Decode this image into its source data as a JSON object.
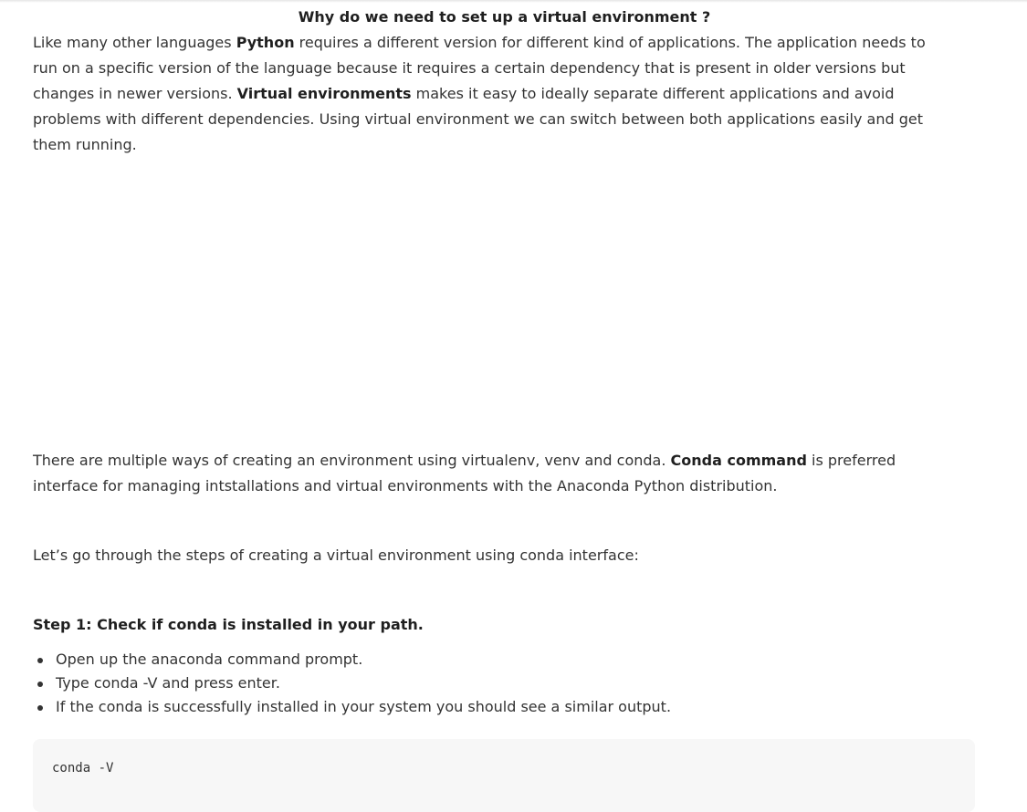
{
  "article": {
    "heading": "Why do we need to set up a virtual environment ?",
    "intro": {
      "t1": "Like many other languages ",
      "b1": "Python",
      "t2": " requires a different version for different kind of applications. The application needs to run on a specific version of the language because it requires a certain dependency that is present in older versions but changes in newer versions. ",
      "b2": "Virtual environments",
      "t3": " makes it easy to ideally separate different applications and avoid problems with different dependencies. Using virtual environment we can switch between both applications easily and get them running."
    },
    "ways": {
      "t1": "There are multiple ways of creating an environment using virtualenv, venv and conda. ",
      "b1": "Conda command",
      "t2": " is preferred interface for managing intstallations and virtual environments with the Anaconda Python distribution."
    },
    "steps_intro": "Let’s go through the steps of creating a virtual environment using conda interface:",
    "step1": {
      "title": "Step 1: Check if conda is installed in your path.",
      "bullets": [
        "Open up the anaconda command prompt.",
        "Type conda -V  and press enter.",
        "If the conda is successfully installed in your system you should see a similar output."
      ],
      "code": "conda -V"
    }
  }
}
